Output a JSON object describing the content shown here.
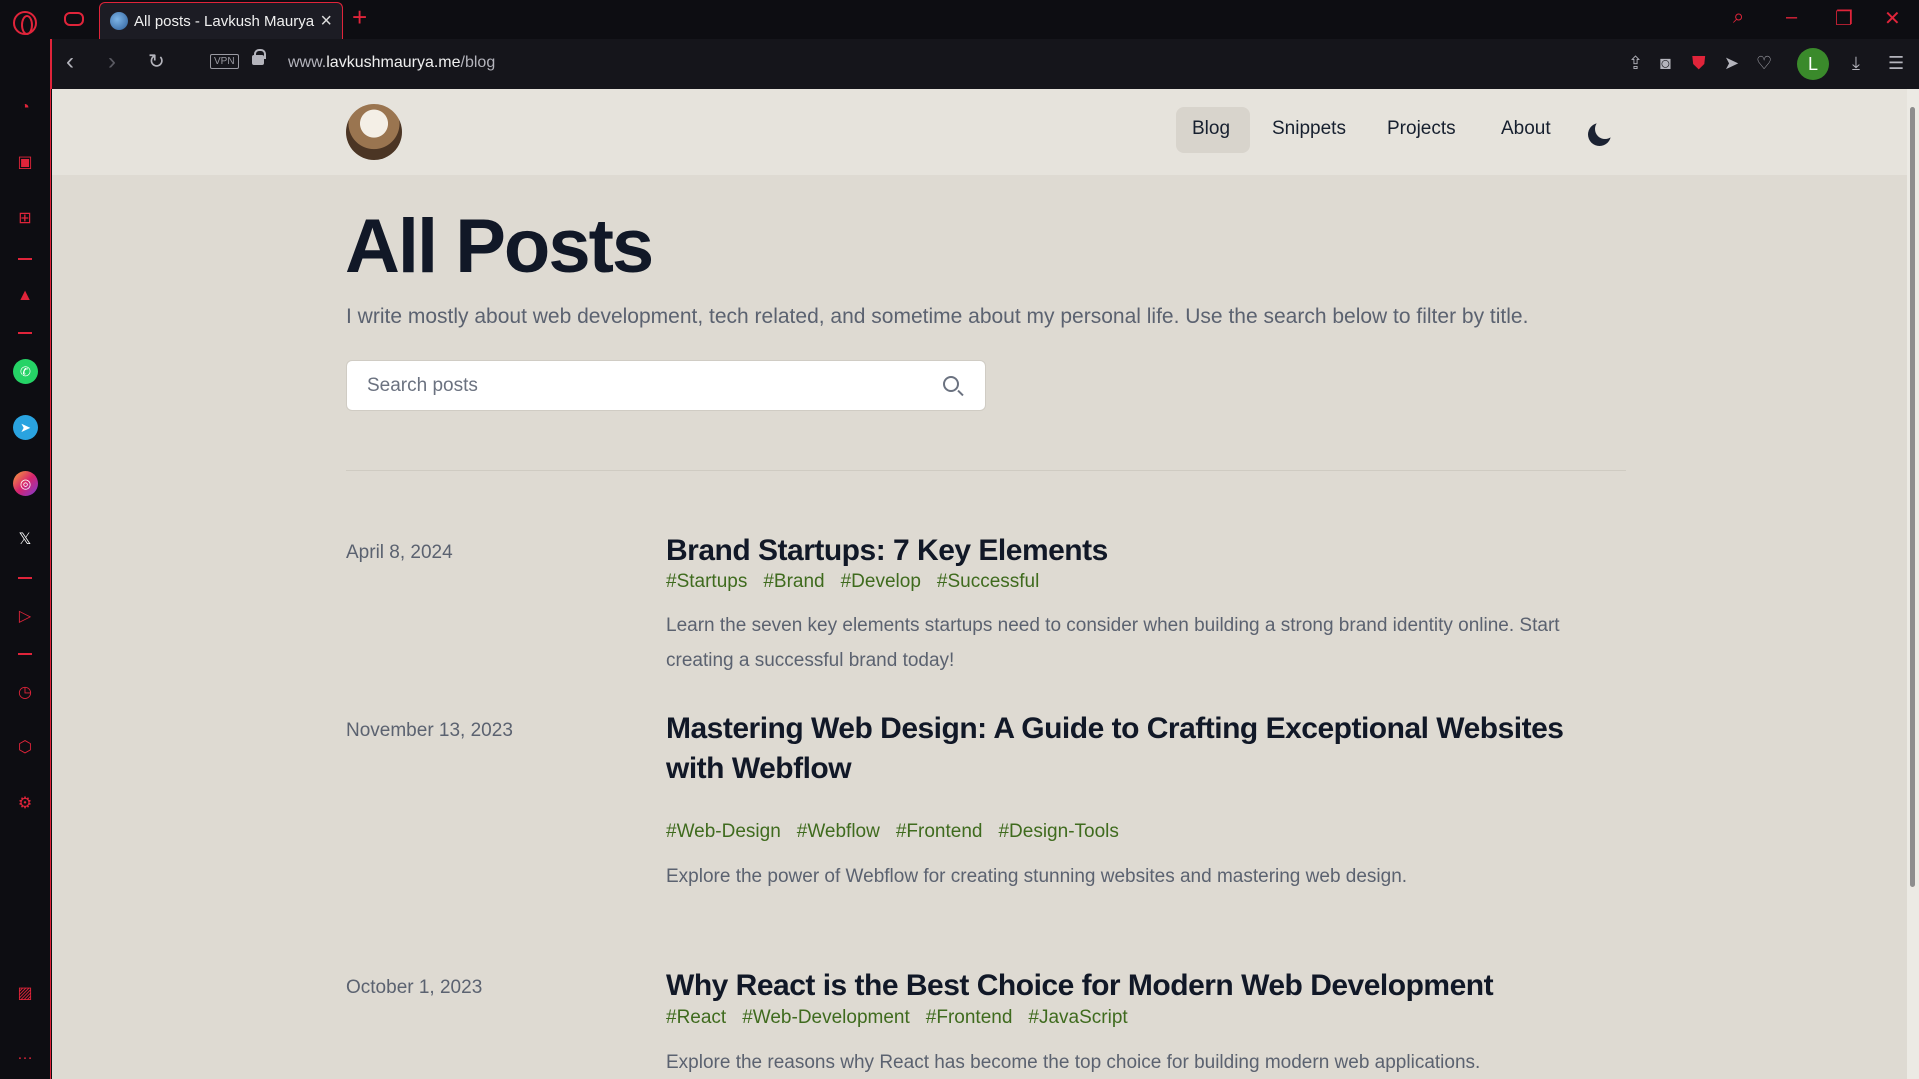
{
  "browser": {
    "tab_title": "All posts - Lavkush Maurya",
    "url_prefix": "www.",
    "url_domain": "lavkushmaurya.me",
    "url_path": "/blog",
    "vpn_label": "VPN",
    "profile_initial": "L",
    "accent_color": "#e0243a"
  },
  "site": {
    "nav": [
      "Blog",
      "Snippets",
      "Projects",
      "About"
    ],
    "active_nav": "Blog",
    "page_title": "All Posts",
    "intro": "I write mostly about web development, tech related, and sometime about my personal life. Use the search below to filter by title.",
    "search_placeholder": "Search posts"
  },
  "posts": [
    {
      "date": "April 8, 2024",
      "title": "Brand Startups: 7 Key Elements",
      "tags": [
        "#Startups",
        "#Brand",
        "#Develop",
        "#Successful"
      ],
      "description": "Learn the seven key elements startups need to consider when building a strong brand identity online. Start creating a successful brand today!"
    },
    {
      "date": "November 13, 2023",
      "title": "Mastering Web Design: A Guide to Crafting Exceptional Websites with Webflow",
      "tags": [
        "#Web-Design",
        "#Webflow",
        "#Frontend",
        "#Design-Tools"
      ],
      "description": "Explore the power of Webflow for creating stunning websites and mastering web design."
    },
    {
      "date": "October 1, 2023",
      "title": "Why React is the Best Choice for Modern Web Development",
      "tags": [
        "#React",
        "#Web-Development",
        "#Frontend",
        "#JavaScript"
      ],
      "description": "Explore the reasons why React has become the top choice for building modern web applications."
    }
  ]
}
